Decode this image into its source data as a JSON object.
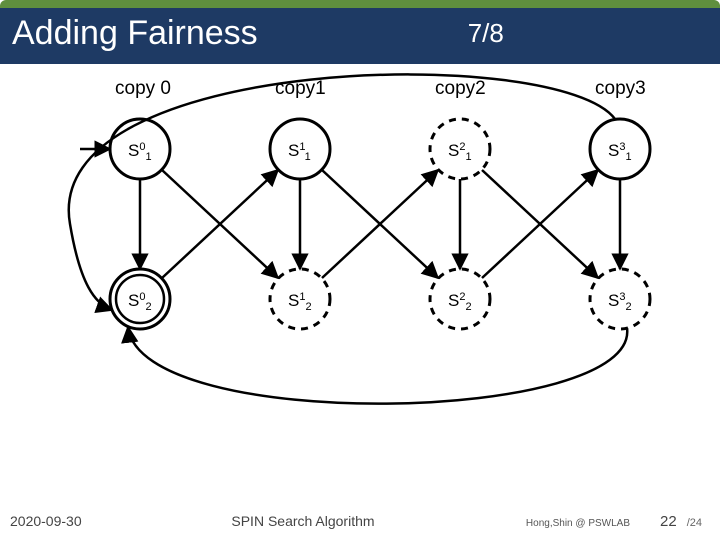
{
  "header": {
    "title": "Adding Fairness",
    "progress": "7/8"
  },
  "columns": [
    "copy 0",
    "copy1",
    "copy2",
    "copy3"
  ],
  "nodes": {
    "s01": {
      "base": "S",
      "sup": "0",
      "sub": "1"
    },
    "s11": {
      "base": "S",
      "sup": "1",
      "sub": "1"
    },
    "s21": {
      "base": "S",
      "sup": "2",
      "sub": "1"
    },
    "s31": {
      "base": "S",
      "sup": "3",
      "sub": "1"
    },
    "s02": {
      "base": "S",
      "sup": "0",
      "sub": "2"
    },
    "s12": {
      "base": "S",
      "sup": "1",
      "sub": "2"
    },
    "s22": {
      "base": "S",
      "sup": "2",
      "sub": "2"
    },
    "s32": {
      "base": "S",
      "sup": "3",
      "sub": "2"
    }
  },
  "footer": {
    "date": "2020-09-30",
    "center": "SPIN Search Algorithm",
    "institution": "Hong,Shin @ PSWLAB",
    "page": "22",
    "total": "/24"
  },
  "chart_data": {
    "type": "diagram",
    "title": "Adding Fairness 7/8",
    "columns": [
      "copy 0",
      "copy1",
      "copy2",
      "copy3"
    ],
    "states": [
      {
        "id": "S0_1",
        "column": 0,
        "row": 1,
        "style": "solid",
        "initial_arrow": true
      },
      {
        "id": "S1_1",
        "column": 1,
        "row": 1,
        "style": "solid"
      },
      {
        "id": "S2_1",
        "column": 2,
        "row": 1,
        "style": "dashed"
      },
      {
        "id": "S3_1",
        "column": 3,
        "row": 1,
        "style": "solid"
      },
      {
        "id": "S0_2",
        "column": 0,
        "row": 2,
        "style": "double"
      },
      {
        "id": "S1_2",
        "column": 1,
        "row": 2,
        "style": "dashed"
      },
      {
        "id": "S2_2",
        "column": 2,
        "row": 2,
        "style": "dashed"
      },
      {
        "id": "S3_2",
        "column": 3,
        "row": 2,
        "style": "dashed"
      }
    ],
    "edges": [
      {
        "from": "S0_1",
        "to": "S0_2"
      },
      {
        "from": "S0_1",
        "to": "S1_2"
      },
      {
        "from": "S1_1",
        "to": "S1_2"
      },
      {
        "from": "S1_1",
        "to": "S2_2"
      },
      {
        "from": "S2_1",
        "to": "S2_2"
      },
      {
        "from": "S2_1",
        "to": "S3_2"
      },
      {
        "from": "S3_1",
        "to": "S3_2"
      },
      {
        "from": "S0_2",
        "to": "S1_1"
      },
      {
        "from": "S1_2",
        "to": "S2_1"
      },
      {
        "from": "S2_2",
        "to": "S3_1"
      },
      {
        "from": "S3_1",
        "to": "S0_1",
        "note": "loop-back"
      },
      {
        "from": "S3_2",
        "to": "S0_2",
        "note": "loop-back"
      }
    ]
  }
}
